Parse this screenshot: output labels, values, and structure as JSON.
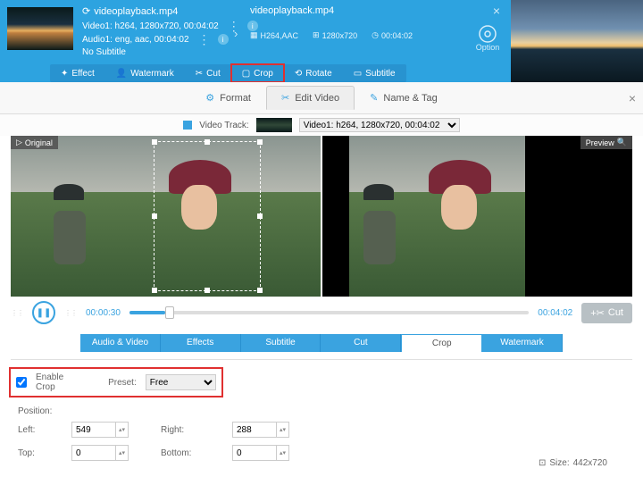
{
  "top": {
    "filename": "videoplayback.mp4",
    "video_line": "Video1: h264, 1280x720, 00:04:02",
    "audio_line": "Audio1: eng, aac, 00:04:02",
    "subtitle_line": "No Subtitle",
    "file2": "videoplayback.mp4",
    "codec": "H264,AAC",
    "res": "1280x720",
    "dur": "00:04:02",
    "option": "Option",
    "codec_badge": "codec"
  },
  "toolbar": {
    "effect": "Effect",
    "watermark": "Watermark",
    "cut": "Cut",
    "crop": "Crop",
    "rotate": "Rotate",
    "subtitle": "Subtitle"
  },
  "tabs2": {
    "format": "Format",
    "edit": "Edit Video",
    "name": "Name & Tag"
  },
  "vtrack": {
    "label": "Video Track:",
    "value": "Video1: h264, 1280x720, 00:04:02"
  },
  "pv": {
    "original": "Original",
    "preview": "Preview"
  },
  "play": {
    "cur": "00:00:30",
    "total": "00:04:02",
    "cut": "Cut"
  },
  "btabs": {
    "av": "Audio & Video",
    "effects": "Effects",
    "subtitle": "Subtitle",
    "cut": "Cut",
    "crop": "Crop",
    "watermark": "Watermark"
  },
  "crop": {
    "enable": "Enable Crop",
    "preset_lbl": "Preset:",
    "preset_val": "Free",
    "position": "Position:",
    "left_lbl": "Left:",
    "left_val": "549",
    "right_lbl": "Right:",
    "right_val": "288",
    "top_lbl": "Top:",
    "top_val": "0",
    "bottom_lbl": "Bottom:",
    "bottom_val": "0",
    "size_lbl": "Size:",
    "size_val": "442x720"
  }
}
